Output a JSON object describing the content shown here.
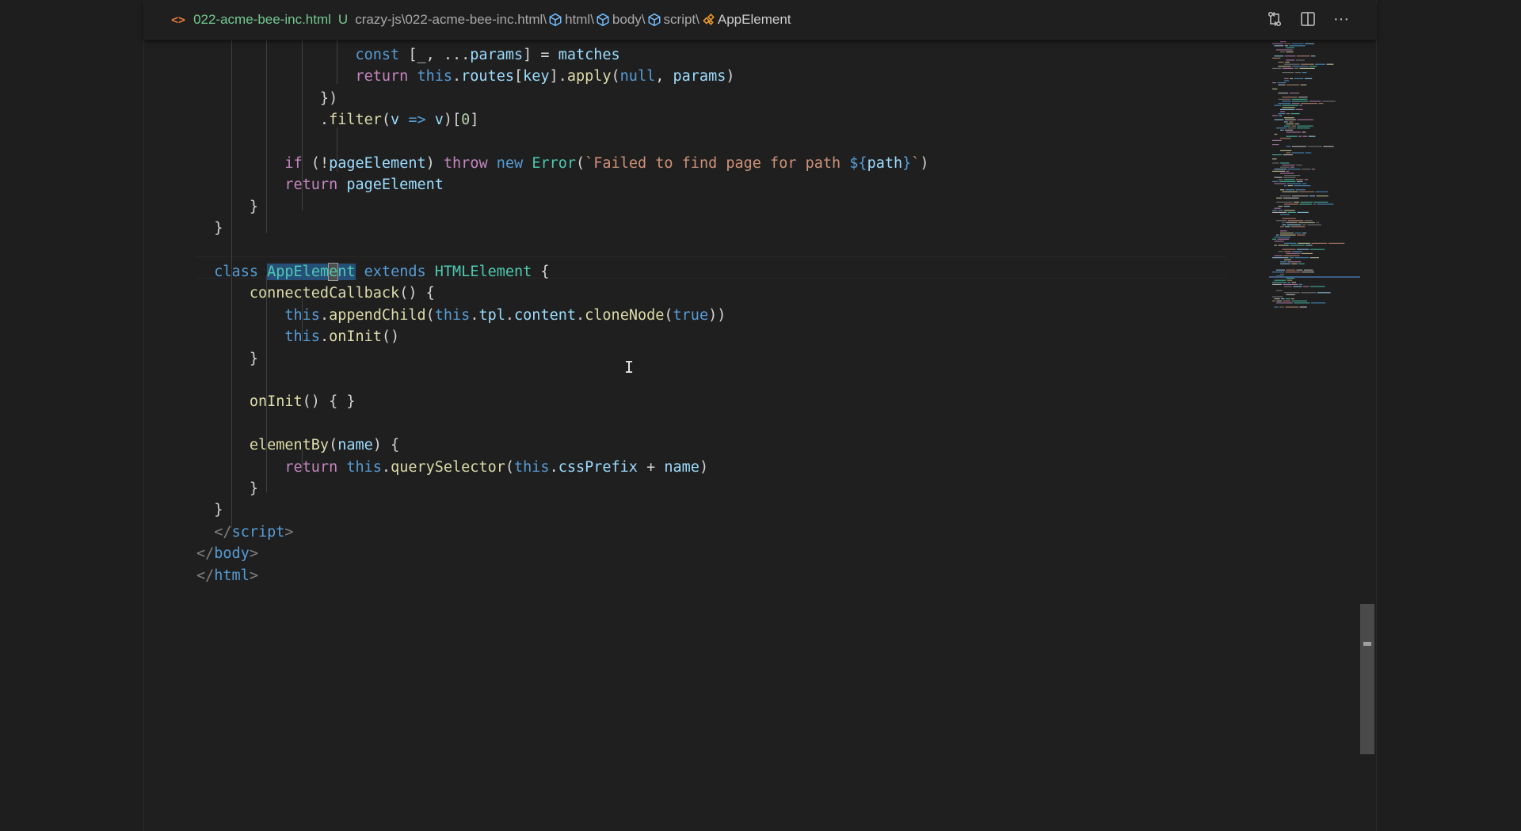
{
  "breadcrumb": {
    "file_icon": "<>",
    "filename": "022-acme-bee-inc.html",
    "git_status": "U",
    "path": "crazy-js\\022-acme-bee-inc.html\\",
    "html": "html",
    "body": "body",
    "script": "script",
    "class_name": "AppElement",
    "sep": "\\"
  },
  "actions": {
    "compare_icon": "git-compare-icon",
    "split_icon": "split-editor-icon",
    "more_icon": "more-actions-icon",
    "more_label": "···"
  },
  "code": {
    "lines": [
      [
        "                  ",
        {
          "t": "const",
          "c": "kw"
        },
        " [_, ...",
        {
          "t": "params",
          "c": "var"
        },
        "] = ",
        {
          "t": "matches",
          "c": "var"
        }
      ],
      [
        "                  ",
        {
          "t": "return",
          "c": "ctl"
        },
        " ",
        {
          "t": "this",
          "c": "kw"
        },
        ".",
        {
          "t": "routes",
          "c": "var"
        },
        "[",
        {
          "t": "key",
          "c": "var"
        },
        "].",
        {
          "t": "apply",
          "c": "fn"
        },
        "(",
        {
          "t": "null",
          "c": "kw"
        },
        ", ",
        {
          "t": "params",
          "c": "var"
        },
        ")"
      ],
      [
        "              })"
      ],
      [
        "              .",
        {
          "t": "filter",
          "c": "fn"
        },
        "(",
        {
          "t": "v",
          "c": "var"
        },
        " ",
        {
          "t": "=>",
          "c": "kw"
        },
        " ",
        {
          "t": "v",
          "c": "var"
        },
        ")[",
        {
          "t": "0",
          "c": "num"
        },
        "]"
      ],
      [
        ""
      ],
      [
        "          ",
        {
          "t": "if",
          "c": "ctl"
        },
        " (!",
        {
          "t": "pageElement",
          "c": "var"
        },
        ") ",
        {
          "t": "throw",
          "c": "ctl"
        },
        " ",
        {
          "t": "new",
          "c": "kw"
        },
        " ",
        {
          "t": "Error",
          "c": "cls"
        },
        "(",
        {
          "t": "`Failed to find page for path ",
          "c": "str"
        },
        {
          "t": "${",
          "c": "kw"
        },
        {
          "t": "path",
          "c": "var"
        },
        {
          "t": "}",
          "c": "kw"
        },
        {
          "t": "`",
          "c": "str"
        },
        ")"
      ],
      [
        "          ",
        {
          "t": "return",
          "c": "ctl"
        },
        " ",
        {
          "t": "pageElement",
          "c": "var"
        }
      ],
      [
        "      }"
      ],
      [
        "  }"
      ],
      [
        ""
      ],
      [
        "  ",
        {
          "t": "class",
          "c": "kw"
        },
        " ",
        {
          "t": "AppElem",
          "c": "hl"
        },
        {
          "t": "e",
          "c": "hl caret-char"
        },
        {
          "t": "nt",
          "c": "hl"
        },
        " ",
        {
          "t": "extends",
          "c": "kw"
        },
        " ",
        {
          "t": "HTMLElement",
          "c": "cls"
        },
        " {"
      ],
      [
        "      ",
        {
          "t": "connectedCallback",
          "c": "fn"
        },
        "() {"
      ],
      [
        "          ",
        {
          "t": "this",
          "c": "kw"
        },
        ".",
        {
          "t": "appendChild",
          "c": "fn"
        },
        "(",
        {
          "t": "this",
          "c": "kw"
        },
        ".",
        {
          "t": "tpl",
          "c": "var"
        },
        ".",
        {
          "t": "content",
          "c": "var"
        },
        ".",
        {
          "t": "cloneNode",
          "c": "fn"
        },
        "(",
        {
          "t": "true",
          "c": "kw"
        },
        "))"
      ],
      [
        "          ",
        {
          "t": "this",
          "c": "kw"
        },
        ".",
        {
          "t": "onInit",
          "c": "fn"
        },
        "()"
      ],
      [
        "      }"
      ],
      [
        ""
      ],
      [
        "      ",
        {
          "t": "onInit",
          "c": "fn"
        },
        "() { }"
      ],
      [
        ""
      ],
      [
        "      ",
        {
          "t": "elementBy",
          "c": "fn"
        },
        "(",
        {
          "t": "name",
          "c": "var"
        },
        ") {"
      ],
      [
        "          ",
        {
          "t": "return",
          "c": "ctl"
        },
        " ",
        {
          "t": "this",
          "c": "kw"
        },
        ".",
        {
          "t": "querySelector",
          "c": "fn"
        },
        "(",
        {
          "t": "this",
          "c": "kw"
        },
        ".",
        {
          "t": "cssPrefix",
          "c": "var"
        },
        " + ",
        {
          "t": "name",
          "c": "var"
        },
        ")"
      ],
      [
        "      }"
      ],
      [
        "  }"
      ],
      {
        "indent": "  ",
        "tags": [
          {
            "t": "</",
            "c": "brk"
          },
          {
            "t": "script",
            "c": "tag"
          },
          {
            "t": ">",
            "c": "brk"
          }
        ]
      },
      {
        "indent": "",
        "tags": [
          {
            "t": "</",
            "c": "brk"
          },
          {
            "t": "body",
            "c": "tag"
          },
          {
            "t": ">",
            "c": "brk"
          }
        ]
      },
      {
        "indent": "",
        "tags": [
          {
            "t": "</",
            "c": "brk"
          },
          {
            "t": "html",
            "c": "tag"
          },
          {
            "t": ">",
            "c": "brk"
          }
        ]
      }
    ]
  },
  "minimap": {
    "label": "minimap"
  },
  "cursor": {
    "glyph": "I"
  }
}
